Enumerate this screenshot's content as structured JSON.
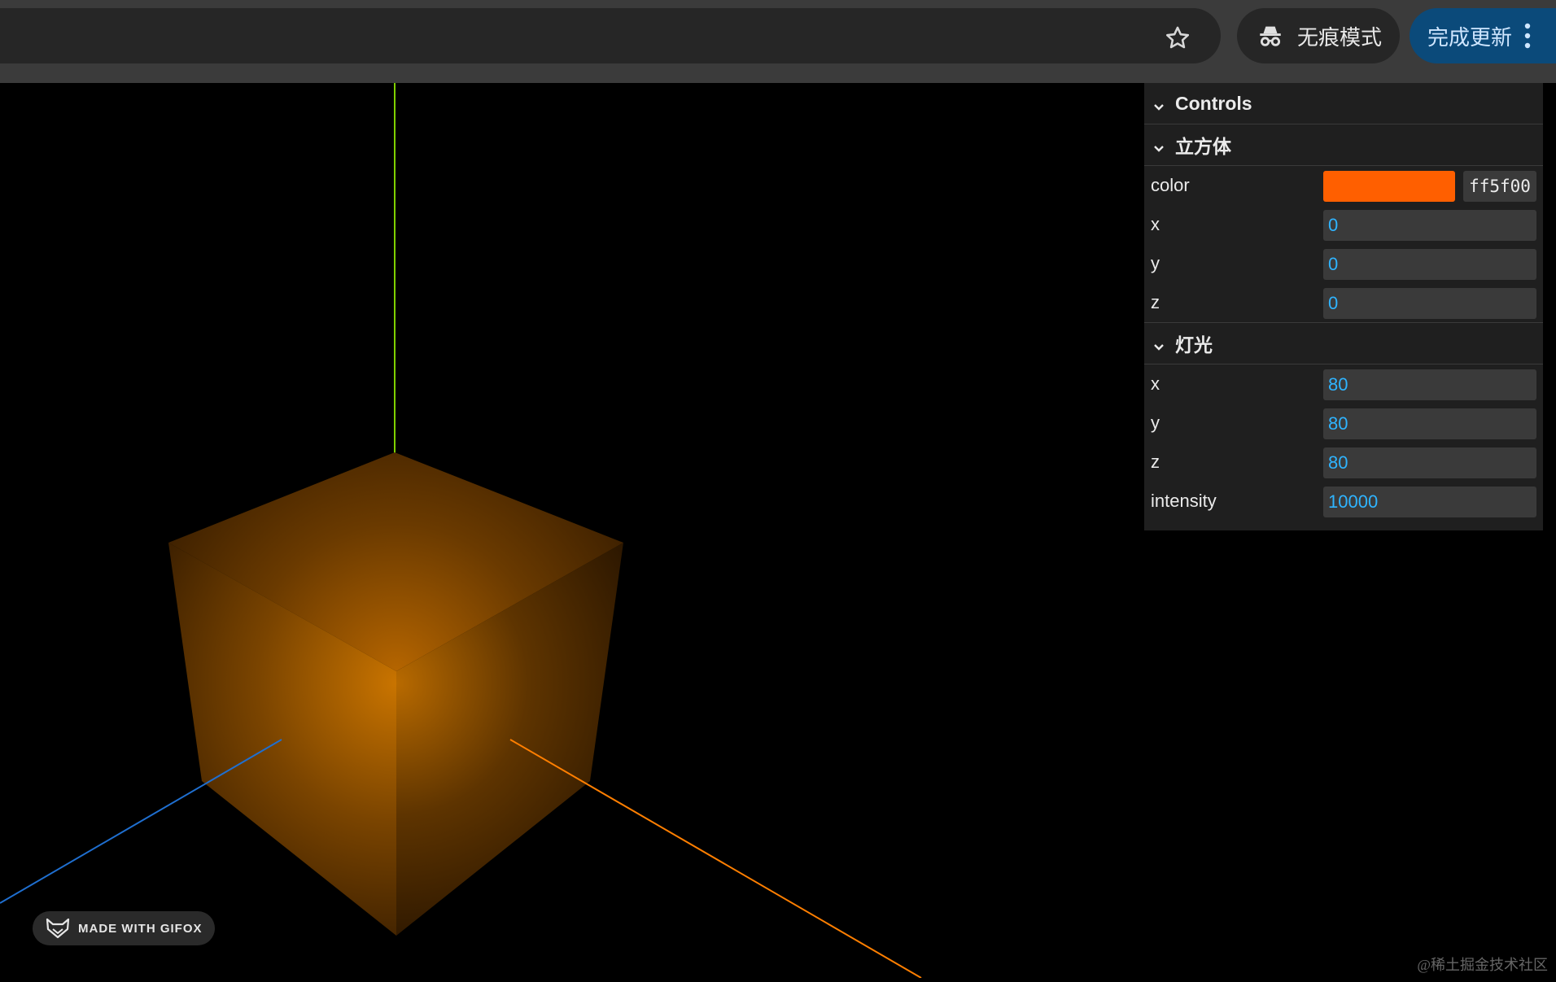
{
  "browser": {
    "incognito_label": "无痕模式",
    "update_label": "完成更新"
  },
  "scene": {
    "cube_color": "#ff5f00",
    "axis_colors": {
      "x": "#ff7f00",
      "y": "#7fff00",
      "z": "#1f6fd0"
    }
  },
  "controls": {
    "title": "Controls",
    "cube": {
      "title": "立方体",
      "color_label": "color",
      "color_value": "ff5f00",
      "x_label": "x",
      "x_value": "0",
      "y_label": "y",
      "y_value": "0",
      "z_label": "z",
      "z_value": "0"
    },
    "light": {
      "title": "灯光",
      "x_label": "x",
      "x_value": "80",
      "y_label": "y",
      "y_value": "80",
      "z_label": "z",
      "z_value": "80",
      "intensity_label": "intensity",
      "intensity_value": "10000"
    }
  },
  "watermarks": {
    "gifox": "MADE WITH GIFOX",
    "juejin": "@稀土掘金技术社区"
  }
}
